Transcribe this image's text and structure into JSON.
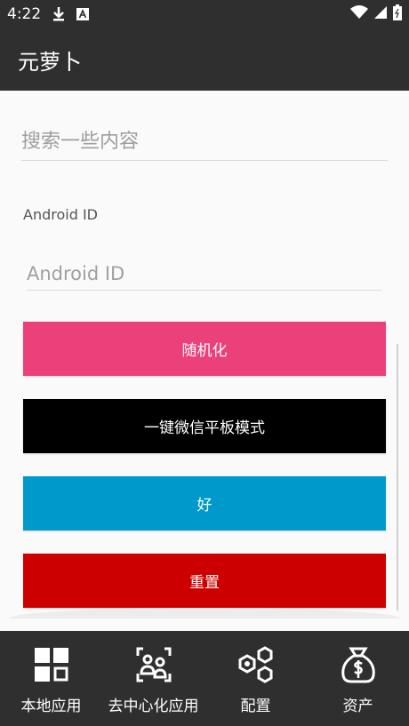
{
  "status_bar": {
    "time": "4:22",
    "icons": [
      "download-icon",
      "a-icon",
      "wifi-icon",
      "signal-icon",
      "battery-icon"
    ]
  },
  "app_bar": {
    "title": "元萝卜"
  },
  "search": {
    "placeholder": "搜索一些内容",
    "value": ""
  },
  "android_id": {
    "label": "Android ID",
    "placeholder": "Android ID",
    "value": ""
  },
  "buttons": {
    "randomize": "随机化",
    "wechat_tablet": "一键微信平板模式",
    "ok": "好",
    "reset": "重置"
  },
  "colors": {
    "randomize": "#ec407a",
    "wechat_tablet": "#000000",
    "ok": "#0099cc",
    "reset": "#cc0000",
    "bar": "#2f2f2f"
  },
  "nav": {
    "items": [
      {
        "label": "本地应用",
        "icon": "grid-icon"
      },
      {
        "label": "去中心化应用",
        "icon": "scan-people-icon"
      },
      {
        "label": "配置",
        "icon": "hexagons-icon"
      },
      {
        "label": "资产",
        "icon": "money-bag-icon"
      }
    ]
  }
}
